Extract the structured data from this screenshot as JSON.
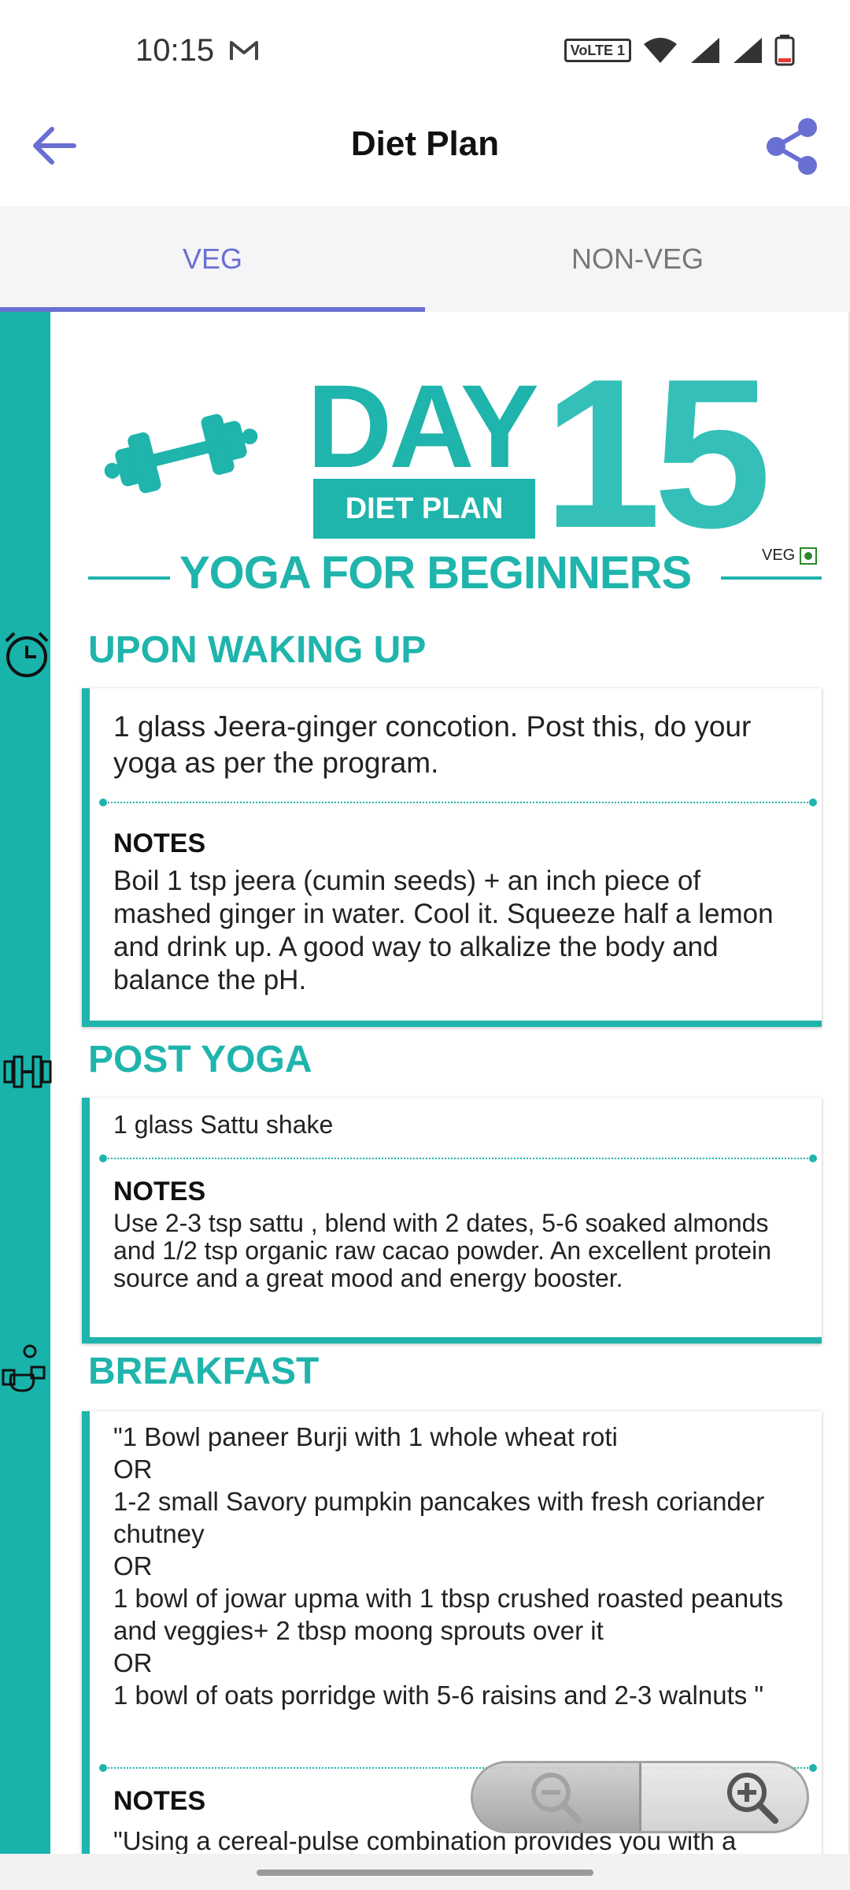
{
  "status_bar": {
    "time": "10:15",
    "volte": "VoLTE 1"
  },
  "app_bar": {
    "title": "Diet Plan"
  },
  "tabs": [
    {
      "label": "VEG",
      "active": true
    },
    {
      "label": "NON-VEG",
      "active": false
    }
  ],
  "header": {
    "day_label": "DAY",
    "day_number": "15",
    "banner": "DIET PLAN",
    "program": "YOGA FOR BEGINNERS",
    "veg_badge": "VEG"
  },
  "sections": [
    {
      "title": "UPON WAKING UP",
      "main": "1 glass Jeera-ginger concotion. Post this, do your yoga as per the program.",
      "notes_label": "NOTES",
      "notes": "Boil 1 tsp jeera (cumin seeds) + an inch piece of mashed ginger in water. Cool it. Squeeze half a lemon and drink up. A good way to alkalize the body and balance the pH."
    },
    {
      "title": "POST YOGA",
      "main": "1 glass Sattu shake",
      "notes_label": "NOTES",
      "notes": "Use 2-3 tsp sattu , blend with 2 dates, 5-6 soaked almonds and 1/2 tsp organic raw cacao powder. An excellent protein source and a great mood and energy booster."
    },
    {
      "title": "BREAKFAST",
      "main": "\"1 Bowl paneer Burji with 1 whole wheat roti\nOR\n1-2 small Savory pumpkin pancakes with fresh coriander chutney\nOR\n1 bowl of jowar upma with 1 tbsp crushed roasted peanuts and veggies+ 2 tbsp moong sprouts over it\nOR\n1 bowl of oats porridge with 5-6 raisins and 2-3 walnuts \"",
      "notes_label": "NOTES",
      "notes": "\"Using a cereal-pulse combination provides you with a"
    }
  ],
  "colors": {
    "accent": "#6a6fd2",
    "teal": "#1fb4ac",
    "teal_light": "#34c0b8"
  }
}
